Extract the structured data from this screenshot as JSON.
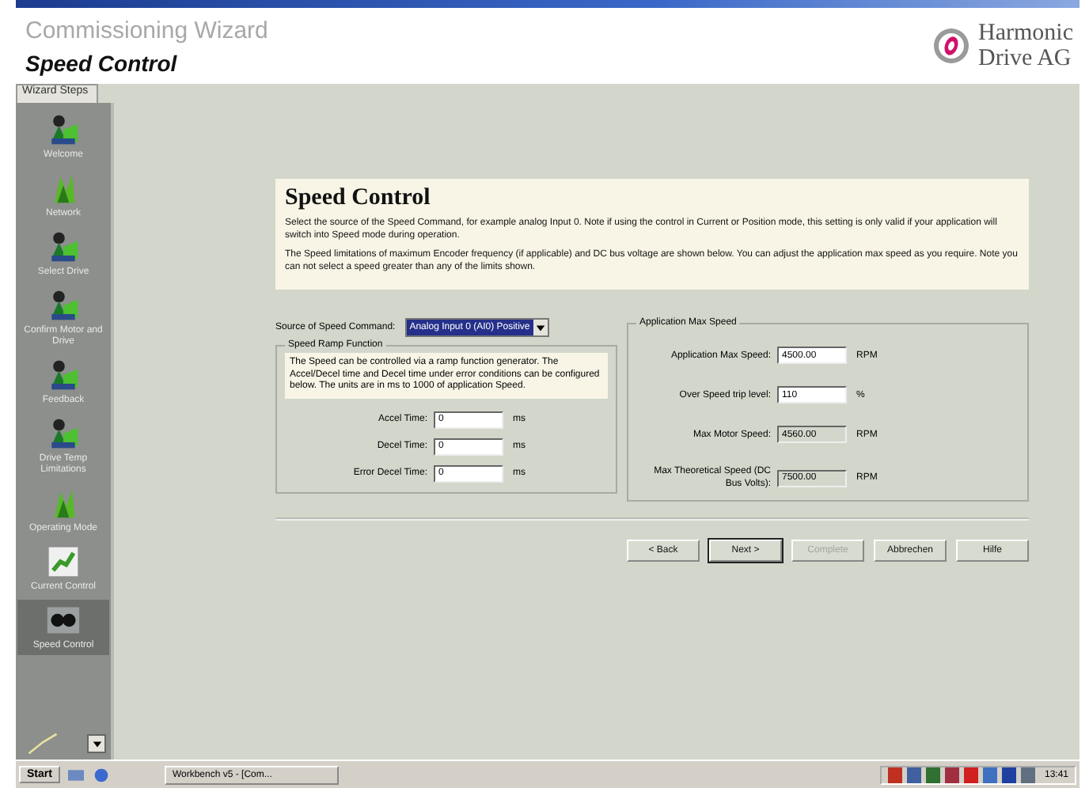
{
  "header": {
    "app_title": "Commissioning Wizard",
    "page_title": "Speed Control",
    "brand": [
      "Harmonic",
      "Drive AG"
    ]
  },
  "sidebar": {
    "tab": "Wizard Steps",
    "items": [
      {
        "label": "Welcome",
        "kind": "person",
        "selected": false
      },
      {
        "label": "Network",
        "kind": "plant",
        "selected": false
      },
      {
        "label": "Select Drive",
        "kind": "person",
        "selected": false
      },
      {
        "label": "Confirm Motor and Drive",
        "kind": "person",
        "selected": false
      },
      {
        "label": "Feedback",
        "kind": "person",
        "selected": false
      },
      {
        "label": "Drive Temp Limitations",
        "kind": "person",
        "selected": false
      },
      {
        "label": "Operating Mode",
        "kind": "plant",
        "selected": false
      },
      {
        "label": "Current Control",
        "kind": "chart",
        "selected": false
      },
      {
        "label": "Speed Control",
        "kind": "knobs",
        "selected": true
      }
    ]
  },
  "intro": {
    "title": "Speed Control",
    "paragraphs": [
      "Select the source of the Speed Command, for example analog Input 0. Note if using the control in Current or Position mode, this setting is only valid if your application will switch into Speed mode during operation.",
      "The Speed limitations of maximum Encoder frequency (if applicable) and DC bus voltage are shown below. You can adjust the application max speed as you require. Note you can not select a speed greater than any of the limits shown."
    ]
  },
  "source": {
    "label": "Source of Speed Command:",
    "value": "Analog Input 0 (AI0) Positive"
  },
  "ramp": {
    "title": "Speed Ramp Function",
    "note": "The Speed can be controlled via a ramp function generator. The Accel/Decel time and Decel time under error conditions can be configured below. The units are in ms to 1000 of application Speed.",
    "fields": [
      {
        "label": "Accel Time:",
        "value": "0",
        "unit": "ms"
      },
      {
        "label": "Decel Time:",
        "value": "0",
        "unit": "ms"
      },
      {
        "label": "Error Decel Time:",
        "value": "0",
        "unit": "ms"
      }
    ]
  },
  "max_speed": {
    "title": "Application Max Speed",
    "fields": [
      {
        "label": "Application Max Speed:",
        "value": "4500.00",
        "unit": "RPM",
        "disabled": false
      },
      {
        "label": "Over Speed trip level:",
        "value": "110",
        "unit": "%",
        "disabled": false
      },
      {
        "label": "Max Motor Speed:",
        "value": "4560.00",
        "unit": "RPM",
        "disabled": true
      },
      {
        "label": "Max Theoretical Speed (DC Bus Volts):",
        "value": "7500.00",
        "unit": "RPM",
        "disabled": true
      }
    ]
  },
  "buttons": [
    {
      "label": "< Back",
      "disabled": false,
      "default": false
    },
    {
      "label": "Next >",
      "disabled": false,
      "default": true
    },
    {
      "label": "Complete",
      "disabled": true,
      "default": false
    },
    {
      "label": "Abbrechen",
      "disabled": false,
      "default": false
    },
    {
      "label": "Hilfe",
      "disabled": false,
      "default": false
    }
  ],
  "taskbar": {
    "start": "Start",
    "task": "Workbench v5 - [Com...",
    "clock": "13:41"
  }
}
